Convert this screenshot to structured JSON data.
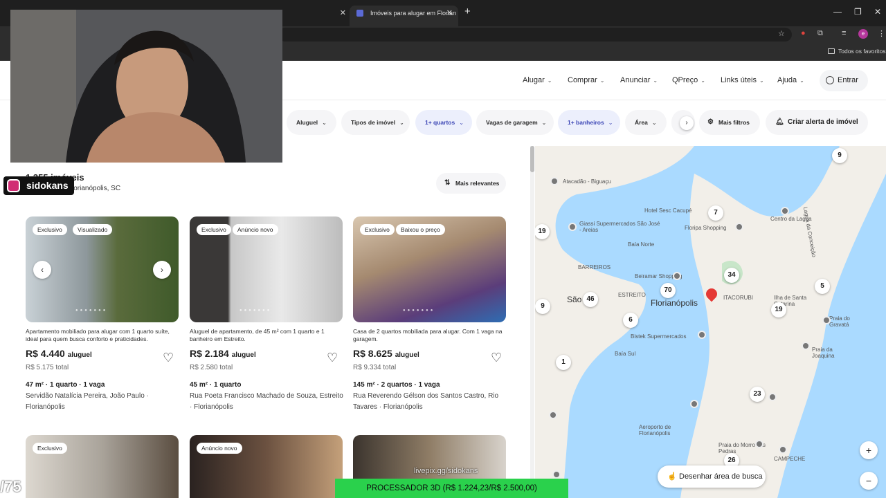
{
  "browser": {
    "tabs": [
      {
        "title": "",
        "active": false
      },
      {
        "title": "Imóveis para alugar em Florian",
        "active": true
      }
    ],
    "new_tab": "+",
    "bookmarks_all": "Todos os favoritos",
    "profile_initial": "e"
  },
  "header": {
    "nav": [
      {
        "label": "Alugar"
      },
      {
        "label": "Comprar"
      },
      {
        "label": "Anunciar"
      },
      {
        "label": "QPreço"
      },
      {
        "label": "Links úteis"
      },
      {
        "label": "Ajuda"
      }
    ],
    "login_label": "Entrar"
  },
  "filters": {
    "chips": [
      {
        "label": "Aluguel",
        "selected": false
      },
      {
        "label": "Tipos de imóvel",
        "selected": false
      },
      {
        "label": "1+ quartos",
        "selected": true
      },
      {
        "label": "Vagas de garagem",
        "selected": false
      },
      {
        "label": "1+ banheiros",
        "selected": true
      },
      {
        "label": "Área",
        "selected": false
      }
    ],
    "more_filters": "Mais filtros",
    "alert": "Criar alerta de imóvel"
  },
  "results": {
    "count": "1.355 imóveis",
    "location": "lorianópolis, SC",
    "sort_label": "Mais relevantes"
  },
  "listings": [
    {
      "badges": [
        "Exclusivo",
        "Visualizado"
      ],
      "description": "Apartamento mobiliado para alugar com 1 quarto suíte, ideal para quem busca conforto e praticidades.",
      "price": "R$ 4.440",
      "price_suffix": "aluguel",
      "total": "R$ 5.175 total",
      "specs": "47 m² · 1 quarto · 1 vaga",
      "address": "Servidão Natalícia Pereira, João Paulo · Florianópolis"
    },
    {
      "badges": [
        "Exclusivo",
        "Anúncio novo"
      ],
      "description": "Aluguel de apartamento, de 45 m² com 1 quarto e 1 banheiro em Estreito.",
      "price": "R$ 2.184",
      "price_suffix": "aluguel",
      "total": "R$ 2.580 total",
      "specs": "45 m² · 1 quarto",
      "address": "Rua Poeta Francisco Machado de Souza, Estreito · Florianópolis"
    },
    {
      "badges": [
        "Exclusivo",
        "Baixou o preço"
      ],
      "description": "Casa de 2 quartos mobiliada para alugar. Com 1 vaga na garagem.",
      "price": "R$ 8.625",
      "price_suffix": "aluguel",
      "total": "R$ 9.334 total",
      "specs": "145 m² · 2 quartos · 1 vaga",
      "address": "Rua Reverendo Gélson dos Santos Castro, Rio Tavares · Florianópolis"
    }
  ],
  "listings_row2": [
    {
      "badge": "Exclusivo"
    },
    {
      "badge": "Anúncio novo"
    },
    {
      "badge": ""
    }
  ],
  "map": {
    "clusters": [
      "9",
      "7",
      "19",
      "34",
      "5",
      "70",
      "46",
      "9",
      "19",
      "6",
      "1",
      "23",
      "26"
    ],
    "labels": {
      "atacadao": "Atacadão - Biguaçu",
      "hotel": "Hotel Sesc Cacupé",
      "lagoa": "Lagoa da Conceição",
      "baia_norte": "Baía Norte",
      "giassi": "Giassi Supermercados São José - Areias",
      "floripa_shopping": "Floripa Shopping",
      "centro_lagoa": "Centro da Lagoa",
      "barreiros": "BARREIROS",
      "beiramar": "Beiramar Shopping",
      "sao_jose": "São",
      "estreito": "ESTREITO",
      "florianopolis": "Florianópolis",
      "itacorubi": "ITACORUBI",
      "ilha": "Ilha de Santa Catarina",
      "bistek": "Bistek Supermercados",
      "baia_sul": "Baía Sul",
      "aeroporto": "Aeroporto de Florianópolis",
      "morro": "Praia do Morro das Pedras",
      "campeche": "CAMPECHE",
      "gravata": "Praia do Gravatá",
      "joaquina": "Praia da Joaquina"
    },
    "draw_button": "Desenhar área de busca",
    "zoom_in": "+",
    "zoom_out": "−"
  },
  "overlay": {
    "instagram_handle": "sidokans",
    "counter": "/75",
    "banner": "PROCESSADOR 3D (R$ 1.224,23/R$ 2.500,00)",
    "livepix": "livepix.gg/sidokans"
  }
}
